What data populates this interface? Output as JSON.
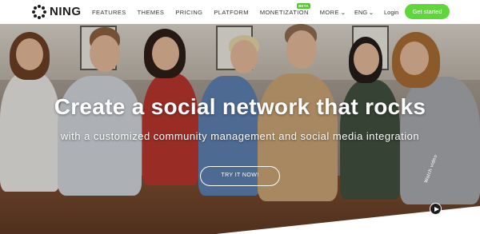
{
  "header": {
    "logo_text": "NING",
    "nav": [
      {
        "label": "FEATURES"
      },
      {
        "label": "THEMES"
      },
      {
        "label": "PRICING"
      },
      {
        "label": "PLATFORM"
      },
      {
        "label": "MONETIZATION",
        "badge": "BETA"
      },
      {
        "label": "MORE"
      }
    ],
    "language": "ENG",
    "login": "Login",
    "cta": "Get started"
  },
  "hero": {
    "title": "Create a social network that rocks",
    "subtitle": "with a customized community management and social media integration",
    "button": "TRY IT NOW!",
    "watch_video": "Watch video"
  },
  "colors": {
    "accent": "#5fd63a",
    "logo": "#1c1c1c"
  },
  "icons": [
    "ning-logo-icon",
    "chevron-down-icon",
    "play-icon"
  ]
}
